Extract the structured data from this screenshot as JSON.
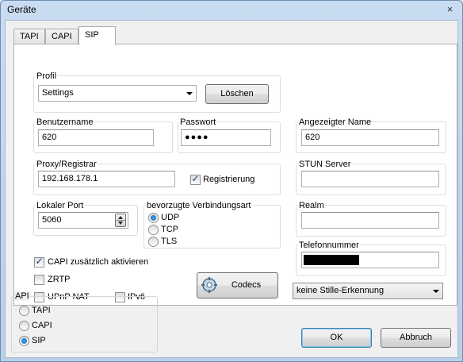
{
  "window": {
    "title": "Geräte",
    "close": "×"
  },
  "tabs": [
    {
      "label": "TAPI"
    },
    {
      "label": "CAPI"
    },
    {
      "label": "SIP"
    }
  ],
  "sip": {
    "profil_label": "Profil",
    "profil_value": "Settings",
    "loeschen": "Löschen",
    "benutzername_label": "Benutzername",
    "benutzername_value": "620",
    "passwort_label": "Passwort",
    "passwort_value": "●●●●",
    "angezeigter_name_label": "Angezeigter Name",
    "angezeigter_name_value": "620",
    "proxy_label": "Proxy/Registrar",
    "proxy_value": "192.168.178.1",
    "registrierung_label": "Registrierung",
    "registrierung_checked": true,
    "stun_label": "STUN Server",
    "stun_value": "",
    "lokaler_port_label": "Lokaler Port",
    "lokaler_port_value": "5060",
    "verbindungsart_label": "bevorzugte Verbindungsart",
    "verbindungsart_options": [
      "UDP",
      "TCP",
      "TLS"
    ],
    "verbindungsart_selected": "UDP",
    "realm_label": "Realm",
    "realm_value": "",
    "telefonnummer_label": "Telefonnummer",
    "capi_zusaetzlich_label": "CAPI zusätzlich aktivieren",
    "capi_zusaetzlich_checked": true,
    "zrtp_label": "ZRTP",
    "upnp_label": "UPnP NAT",
    "ipv6_label": "IPv6",
    "codecs_label": "Codecs",
    "stille_value": "keine Stille-Erkennung"
  },
  "api": {
    "label": "API",
    "options": [
      "TAPI",
      "CAPI",
      "SIP"
    ],
    "selected": "SIP"
  },
  "buttons": {
    "ok": "OK",
    "abbruch": "Abbruch"
  },
  "icons": {
    "close": "close-icon",
    "codecs": "codecs-gear-icon"
  }
}
